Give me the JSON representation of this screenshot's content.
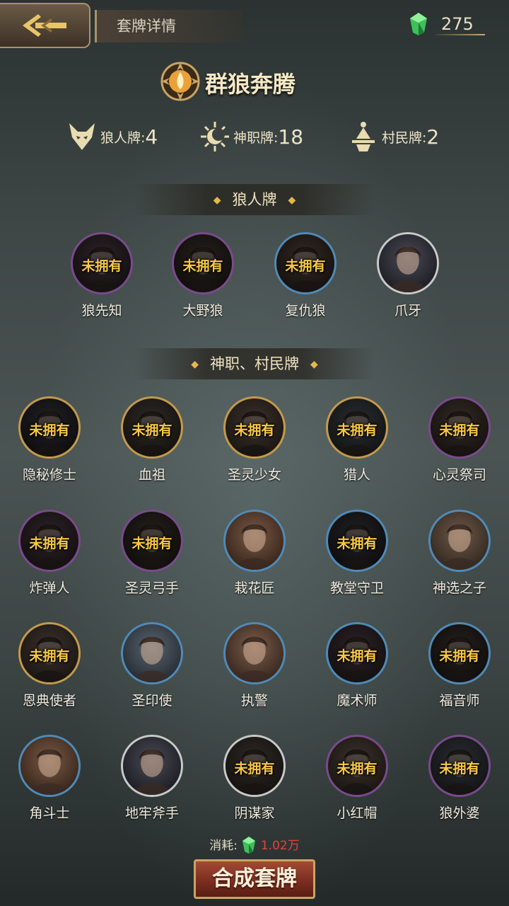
{
  "header": {
    "title": "套牌详情",
    "currency": "275",
    "gem_color": "#3fbf5a"
  },
  "deck": {
    "name": "群狼奔腾"
  },
  "counts": [
    {
      "label": "狼人牌:",
      "value": "4",
      "icon": "wolf-icon"
    },
    {
      "label": "神职牌:",
      "value": "18",
      "icon": "sun-moon-icon"
    },
    {
      "label": "村民牌:",
      "value": "2",
      "icon": "villager-icon"
    }
  ],
  "sections": {
    "wolves": "狼人牌",
    "gods": "神职、村民牌"
  },
  "unowned_label": "未拥有",
  "wolf_cards": [
    {
      "name": "狼先知",
      "owned": false,
      "ring": "purple"
    },
    {
      "name": "大野狼",
      "owned": false,
      "ring": "purple"
    },
    {
      "name": "复仇狼",
      "owned": false,
      "ring": "blue"
    },
    {
      "name": "爪牙",
      "owned": true,
      "ring": "silver"
    }
  ],
  "god_cards": [
    {
      "name": "隐秘修士",
      "owned": false,
      "ring": "gold"
    },
    {
      "name": "血祖",
      "owned": false,
      "ring": "gold"
    },
    {
      "name": "圣灵少女",
      "owned": false,
      "ring": "gold"
    },
    {
      "name": "猎人",
      "owned": false,
      "ring": "gold"
    },
    {
      "name": "心灵祭司",
      "owned": false,
      "ring": "purple"
    },
    {
      "name": "炸弹人",
      "owned": false,
      "ring": "purple"
    },
    {
      "name": "圣灵弓手",
      "owned": false,
      "ring": "purple"
    },
    {
      "name": "栽花匠",
      "owned": true,
      "ring": "blue"
    },
    {
      "name": "教堂守卫",
      "owned": false,
      "ring": "blue"
    },
    {
      "name": "神选之子",
      "owned": true,
      "ring": "blue"
    },
    {
      "name": "恩典使者",
      "owned": false,
      "ring": "gold"
    },
    {
      "name": "圣印使",
      "owned": true,
      "ring": "blue"
    },
    {
      "name": "执警",
      "owned": true,
      "ring": "blue"
    },
    {
      "name": "魔术师",
      "owned": false,
      "ring": "blue"
    },
    {
      "name": "福音师",
      "owned": false,
      "ring": "blue"
    },
    {
      "name": "角斗士",
      "owned": true,
      "ring": "blue"
    },
    {
      "name": "地牢斧手",
      "owned": true,
      "ring": "silver"
    },
    {
      "name": "阴谋家",
      "owned": false,
      "ring": "silver"
    },
    {
      "name": "小红帽",
      "owned": false,
      "ring": "purple"
    },
    {
      "name": "狼外婆",
      "owned": false,
      "ring": "purple"
    }
  ],
  "footer": {
    "cost_label": "消耗:",
    "cost_value": "1.02万",
    "craft_button": "合成套牌"
  }
}
